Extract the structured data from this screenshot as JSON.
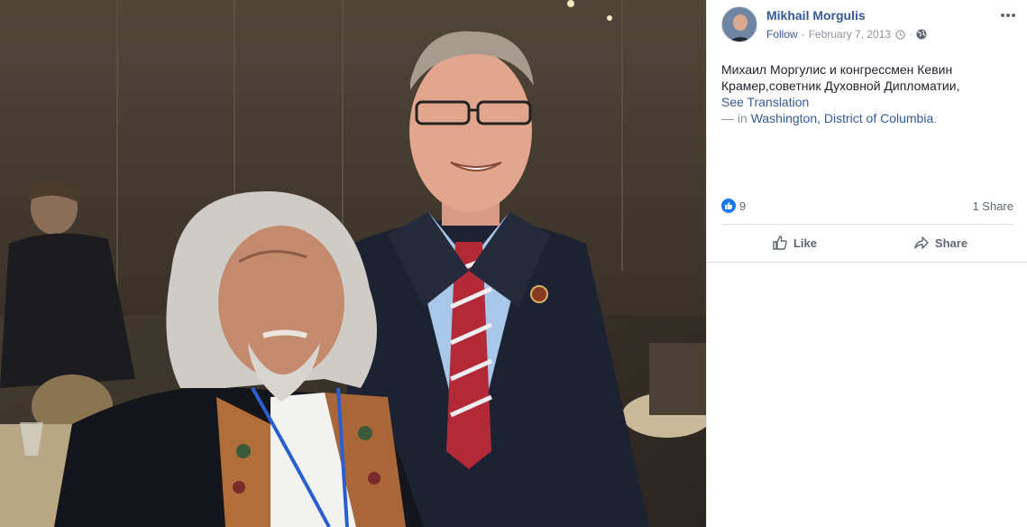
{
  "post": {
    "author_name": "Mikhail Morgulis",
    "follow_label": "Follow",
    "separator": "·",
    "date": "February 7, 2013",
    "clock_icon": "clock-icon",
    "globe_icon": "globe-icon",
    "more_icon": "more-options-icon",
    "text_line1": "Михаил Моргулис и конгрессмен Кевин",
    "text_line2": "Крамер,советник Духовной Дипломатии,",
    "see_translation": "See Translation",
    "location_prefix": "— in ",
    "location": "Washington, District of Columbia",
    "location_suffix": "."
  },
  "reactions": {
    "like_count": "9",
    "share_count": "1 Share"
  },
  "actions": {
    "like_label": "Like",
    "share_label": "Share"
  },
  "colors": {
    "link": "#365899",
    "meta": "#90949c",
    "accent": "#1877f2"
  }
}
